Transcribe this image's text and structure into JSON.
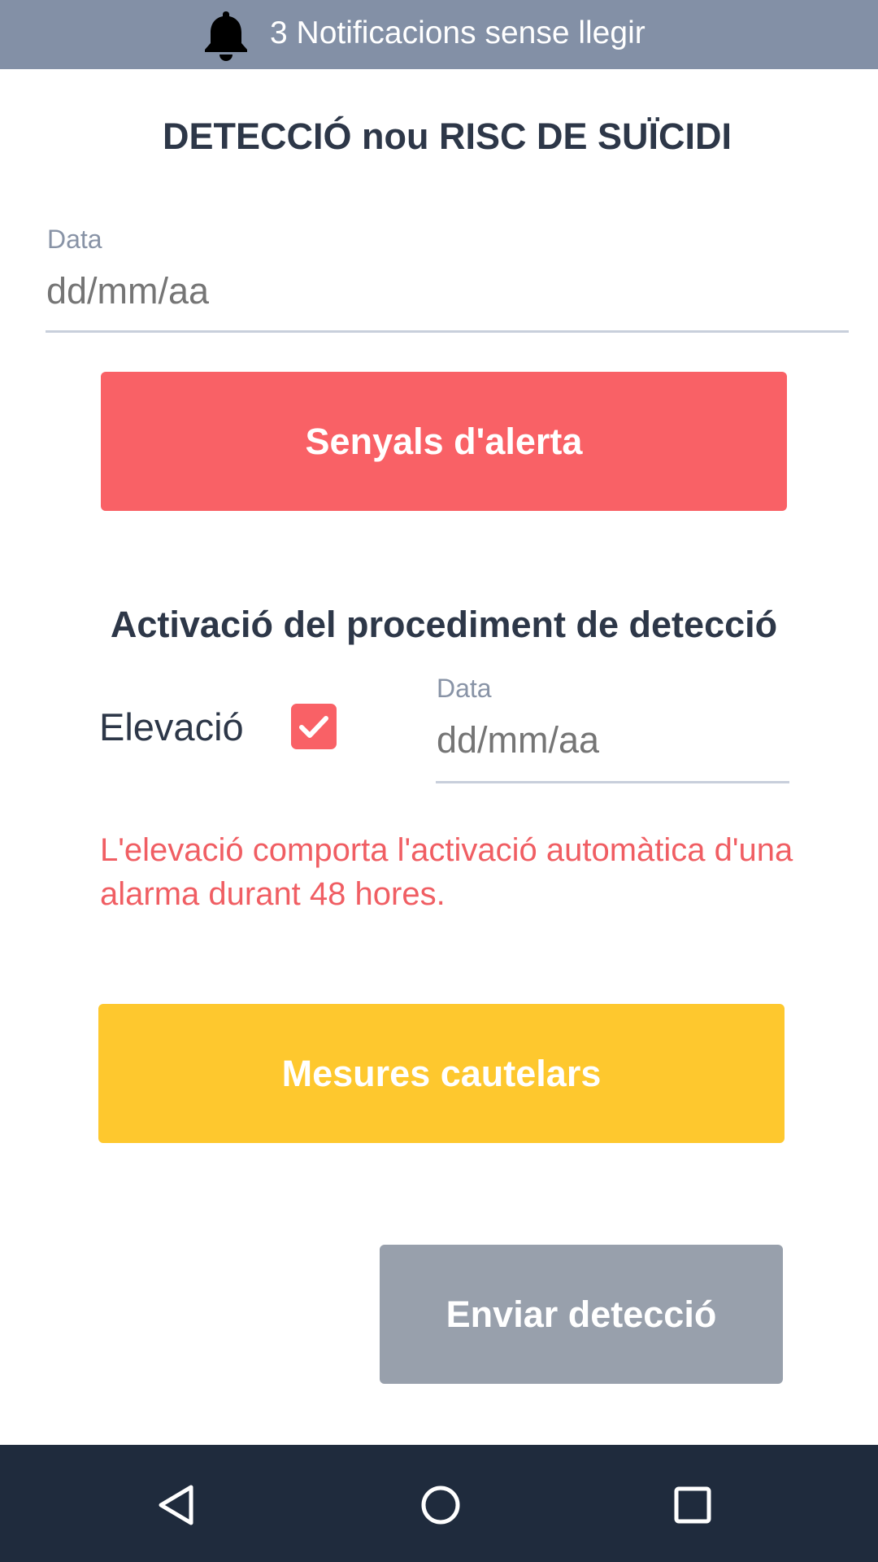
{
  "notification_bar": {
    "icon": "bell-icon",
    "text": "3 Notificacions sense llegir"
  },
  "title": "DETECCIÓ nou RISC DE SUÏCIDI",
  "date_field": {
    "label": "Data",
    "placeholder": "dd/mm/aa"
  },
  "alert_button": {
    "label": "Senyals d'alerta",
    "color": "#f96166"
  },
  "activation": {
    "title": "Activació del procediment de detecció",
    "elevation_label": "Elevació",
    "elevation_checked": true,
    "date_label": "Data",
    "date_placeholder": "dd/mm/aa",
    "warning": "L'elevació comporta l'activació automàtica d'una alarma durant 48 hores."
  },
  "measures_button": {
    "label": "Mesures cautelars",
    "color": "#fec82e"
  },
  "send_button": {
    "label": "Enviar detecció",
    "color": "#98a0ac"
  },
  "nav": {
    "back_icon": "back-triangle-icon",
    "home_icon": "home-circle-icon",
    "recents_icon": "recents-square-icon"
  },
  "colors": {
    "notification_bar": "#8390a6",
    "nav_bar": "#1f2b3d",
    "text": "#2d3748",
    "warning": "#f05e63"
  }
}
